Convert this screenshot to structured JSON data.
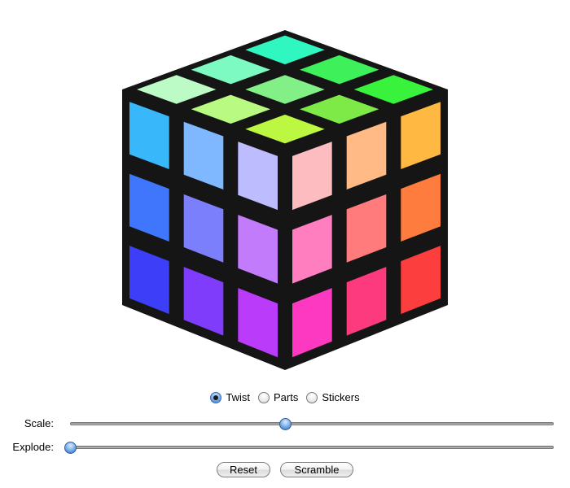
{
  "cube": {
    "background": "#ffffff",
    "edge_color": "#151515",
    "faces": {
      "top": [
        [
          "#30f6c0",
          "#3ef05a",
          "#39f23c"
        ],
        [
          "#7cfac2",
          "#82f086",
          "#7eea48"
        ],
        [
          "#bdfbc6",
          "#b8fa82",
          "#bcf742"
        ]
      ],
      "left": [
        [
          "#39b7fb",
          "#80b8ff",
          "#bdbcff"
        ],
        [
          "#3f76fb",
          "#7b7ffb",
          "#c17bfb"
        ],
        [
          "#3d3ff8",
          "#7f3cfb",
          "#bb3bfa"
        ]
      ],
      "right": [
        [
          "#fdbdc0",
          "#ffba85",
          "#ffb842"
        ],
        [
          "#ff7ec0",
          "#ff7b7c",
          "#fd7c3e"
        ],
        [
          "#fd39c2",
          "#fd3a7e",
          "#fd3e3f"
        ]
      ]
    }
  },
  "modes": {
    "options": [
      {
        "label": "Twist",
        "selected": true
      },
      {
        "label": "Parts",
        "selected": false
      },
      {
        "label": "Stickers",
        "selected": false
      }
    ]
  },
  "sliders": {
    "scale": {
      "label": "Scale:",
      "value_fraction": 0.445
    },
    "explode": {
      "label": "Explode:",
      "value_fraction": 0.0
    }
  },
  "buttons": {
    "reset_label": "Reset",
    "scramble_label": "Scramble"
  }
}
